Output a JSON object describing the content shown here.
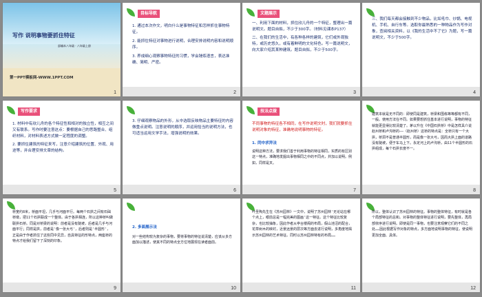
{
  "slides": [
    {
      "num": "1",
      "title": "写作  说明事物要抓住特征",
      "subtitle": "部编本八年级 · 八年级上册",
      "website": "第一PPT模板网-WWW.1PPT.COM"
    },
    {
      "num": "2",
      "tag": "目标导航",
      "lines": [
        "1. 通过本次作文，明白什么是事物特征和怎样抓住事物特征。",
        "2. 能抓住特征对事物进行说明，合理安排说明内容和说明顺序。",
        "3. 养成细心观察事物特征的习惯，学会锤炼语言，表达准确、简明、严密。"
      ]
    },
    {
      "num": "3",
      "tag": "文题展示",
      "lines": [
        "一、利用下面的材料，抓住欣儿舟的一个特征，整理出一篇说明文。题目自拟，不少于300字。（材料见课本P137）",
        "二、在我们的生活中，有各种各样的建筑，它们或外观独特，或历史悠久，或有着鲜明的文化特色。写一篇说明文，向大家介绍其某种建筑。题目自拟，不少于500字。"
      ]
    },
    {
      "num": "4",
      "lines": [
        "三、我们每天都会接触到不少物品，比如毛巾、炒锅、电视机、手机、自行车等。选取你最熟悉的一种物品作为写作对象，查阅相关资料，以《我的生活中不了它》为题，写一篇说明文，不少于500字。"
      ]
    },
    {
      "num": "5",
      "tag": "写作要求",
      "lines": [
        "1. 材料中有欣儿舟的各个特征性和相对的独立性，相互之间又有联系。写作时要注意这点：要根据自己的思路整合、组织材料，对材料表述方式做一定程度的调整。",
        "2. 要抓住建筑的特征来写，注意介绍建筑的位置、外观、用途等，并合理安排文章的结构。"
      ]
    },
    {
      "num": "6",
      "lines": [
        "3. 仔细观察物品的外形，从中选取反映物品主要特征的内容做重点说明。注意说明的顺序，并运用恰当的说明方法，也可适当运用文学手法，增强说明的效果。"
      ]
    },
    {
      "num": "7",
      "tag": "技法点拨",
      "lines": [
        "不同事物的特征各不相同，在写作说明文时，我们就要抓住说明对象的特征，准确地说明事物的特征。"
      ],
      "heading": "1. 同中求异法",
      "body": "说明这种方法，要求我们善于利用事物的特征相同，实质的有区别这一特点，准确地发掘出事物相同之中的不同点，并加以说明。例如，同样是叉。"
    },
    {
      "num": "8",
      "body": "建筑本就是无不同的：即使同是建筑，桥梁和围栋等等都有不同，一般。使用方法在不同。如果要想抓住基本进行说明，事物的特征就能更显得比较清楚了。茅以升在《中国石拱桥》中是怎样具介说赵州桥和卢沟桥的——（赵州桥）这桥的特点是：全桥只有一个大拱，桥洞不是普通半圆形，而是像一张大弓，因而大拱上面的道路没有陡坡，便于车马上下。永定河上的卢沟桥，由11个半圆形的石拱组成，每个石拱长度不一。"
    },
    {
      "num": "9",
      "body": "桥宽约8米，桥面平坦，几乎与河面平行。每两个石拱之间有石础桥墩，把11个石拱联成一个整体。由于各拱相连，所以这种桥叫做联拱石桥。同是对桥梁的说明：前者是没有陡坡，后者是几乎与河面平行；同样是拱，前者是'像一张大弓'，后者则是'半圆形'，正是由于作者抓住了这些同中见异，自具特征的形特点，两座桥的特点才给我们留下了深刻的印象。"
    },
    {
      "num": "10",
      "heading": "2. 多面展示法",
      "body": "对一些结构较为复杂的事物，要将事物的特征说清楚，应该从多方面加以描述，使其不同的特点全方位地展现在读者面前。"
    },
    {
      "num": "11",
      "body": "叶圣陶先生在《苏州园林》一文中，说明了苏州园林'无论站在哪个点上，眼前总是一幅完美的图画'这一特征。这个特征比较复杂，也比较抽象，因此作者从亭台楼阁的布局，假山池沼的配合，花草树木的映衬，近景远景的层次等方面去进行说明，多角度地揭示苏州园林的艺术特征。同时以苏州园林特有的布局……"
    },
    {
      "num": "12",
      "body": "所以，整体认识了苏州园林的特征。事物的整体特征，有时就是各个局部特征的总和。对事物的整体特征进行说明，要先整体，再局部依序进行说明。即使是同一事物，也要注意观察它们的不同之处……因此根据写作对象的特点，多方面地说明事物的特征，使说明更加全面、具体。"
    }
  ],
  "colors": {
    "leaf": "#48b13a",
    "tag_pink": "#e9507a",
    "tag_yellow": "#f4b400",
    "tag_cyan": "#22a6d8",
    "text_blue": "#1a2f6e",
    "text_red": "#d01818",
    "background": "#8a8a8a"
  }
}
